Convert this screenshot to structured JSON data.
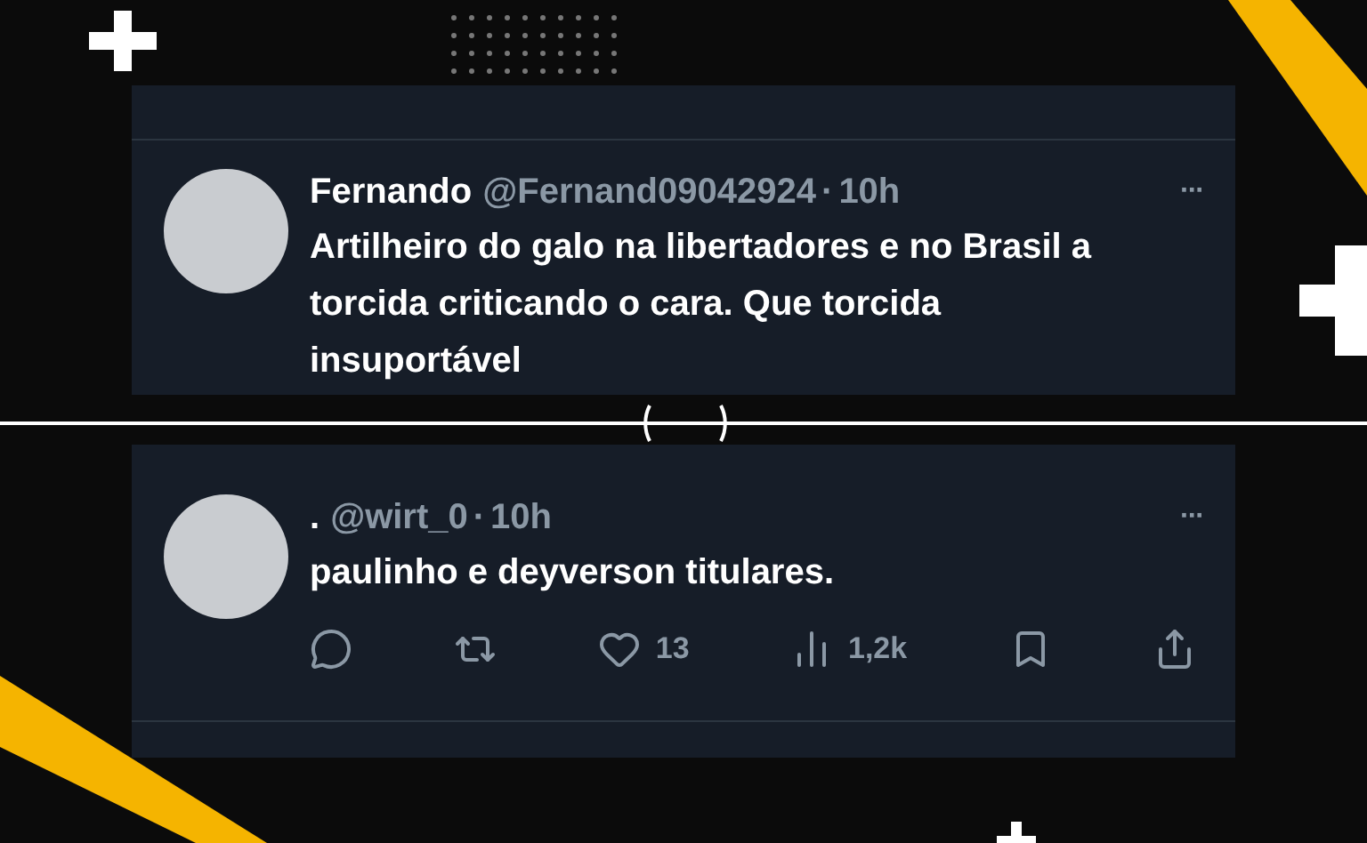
{
  "tweets": [
    {
      "name": "Fernando",
      "handle": "@Fernand09042924",
      "separator": "·",
      "time": "10h",
      "more": "···",
      "text": "Artilheiro do galo na libertadores e no Brasil a torcida criticando o cara. Que torcida insuportável",
      "kind": "quoted"
    },
    {
      "name": ".",
      "handle": "@wirt_0",
      "separator": "·",
      "time": "10h",
      "more": "···",
      "text": "paulinho e deyverson titulares.",
      "kind": "reply",
      "actions": [
        {
          "kind": "reply"
        },
        {
          "kind": "retweet"
        },
        {
          "kind": "like",
          "count": "13"
        },
        {
          "kind": "views",
          "count": "1,2k"
        },
        {
          "kind": "bookmark"
        },
        {
          "kind": "share"
        }
      ]
    }
  ]
}
